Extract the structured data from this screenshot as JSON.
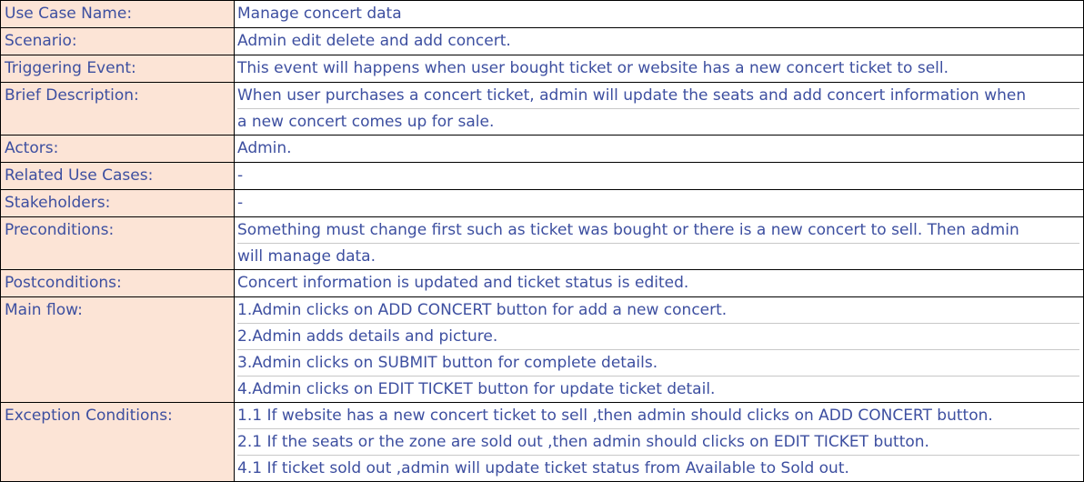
{
  "colors": {
    "label_bg": "#fce4d6",
    "text": "#3d4fa0",
    "border": "#000000"
  },
  "rows": [
    {
      "label": "Use Case Name:",
      "lines": [
        "Manage concert data"
      ]
    },
    {
      "label": "Scenario:",
      "lines": [
        "Admin edit delete and add concert."
      ]
    },
    {
      "label": "Triggering Event:",
      "lines": [
        "This event will happens when user bought ticket or website has a new concert ticket to sell."
      ]
    },
    {
      "label": "Brief Description:",
      "lines": [
        "When user purchases a concert ticket, admin will update the seats and add concert information when",
        "a new concert comes up for sale."
      ]
    },
    {
      "label": "Actors:",
      "lines": [
        "Admin."
      ]
    },
    {
      "label": "Related Use Cases:",
      "lines": [
        "-"
      ]
    },
    {
      "label": "Stakeholders:",
      "lines": [
        "-"
      ]
    },
    {
      "label": "Preconditions:",
      "lines": [
        "Something must change first such as ticket was bought or there is a new concert to sell. Then admin",
        "will manage data."
      ]
    },
    {
      "label": "Postconditions:",
      "lines": [
        "Concert information is updated and ticket status is edited."
      ]
    },
    {
      "label": "Main flow:",
      "lines": [
        "1.Admin clicks on ADD CONCERT button for add a new concert.",
        "2.Admin adds details and picture.",
        "3.Admin clicks on SUBMIT button for complete details.",
        "4.Admin clicks on EDIT TICKET button for update ticket detail."
      ]
    },
    {
      "label": "Exception Conditions:",
      "lines": [
        "1.1 If website has a new concert ticket to sell ,then admin should clicks on ADD CONCERT button.",
        "2.1 If the seats or the zone are sold out ,then admin should clicks on EDIT TICKET button.",
        "4.1 If ticket sold out ,admin will update ticket status from Available to Sold out."
      ]
    }
  ]
}
